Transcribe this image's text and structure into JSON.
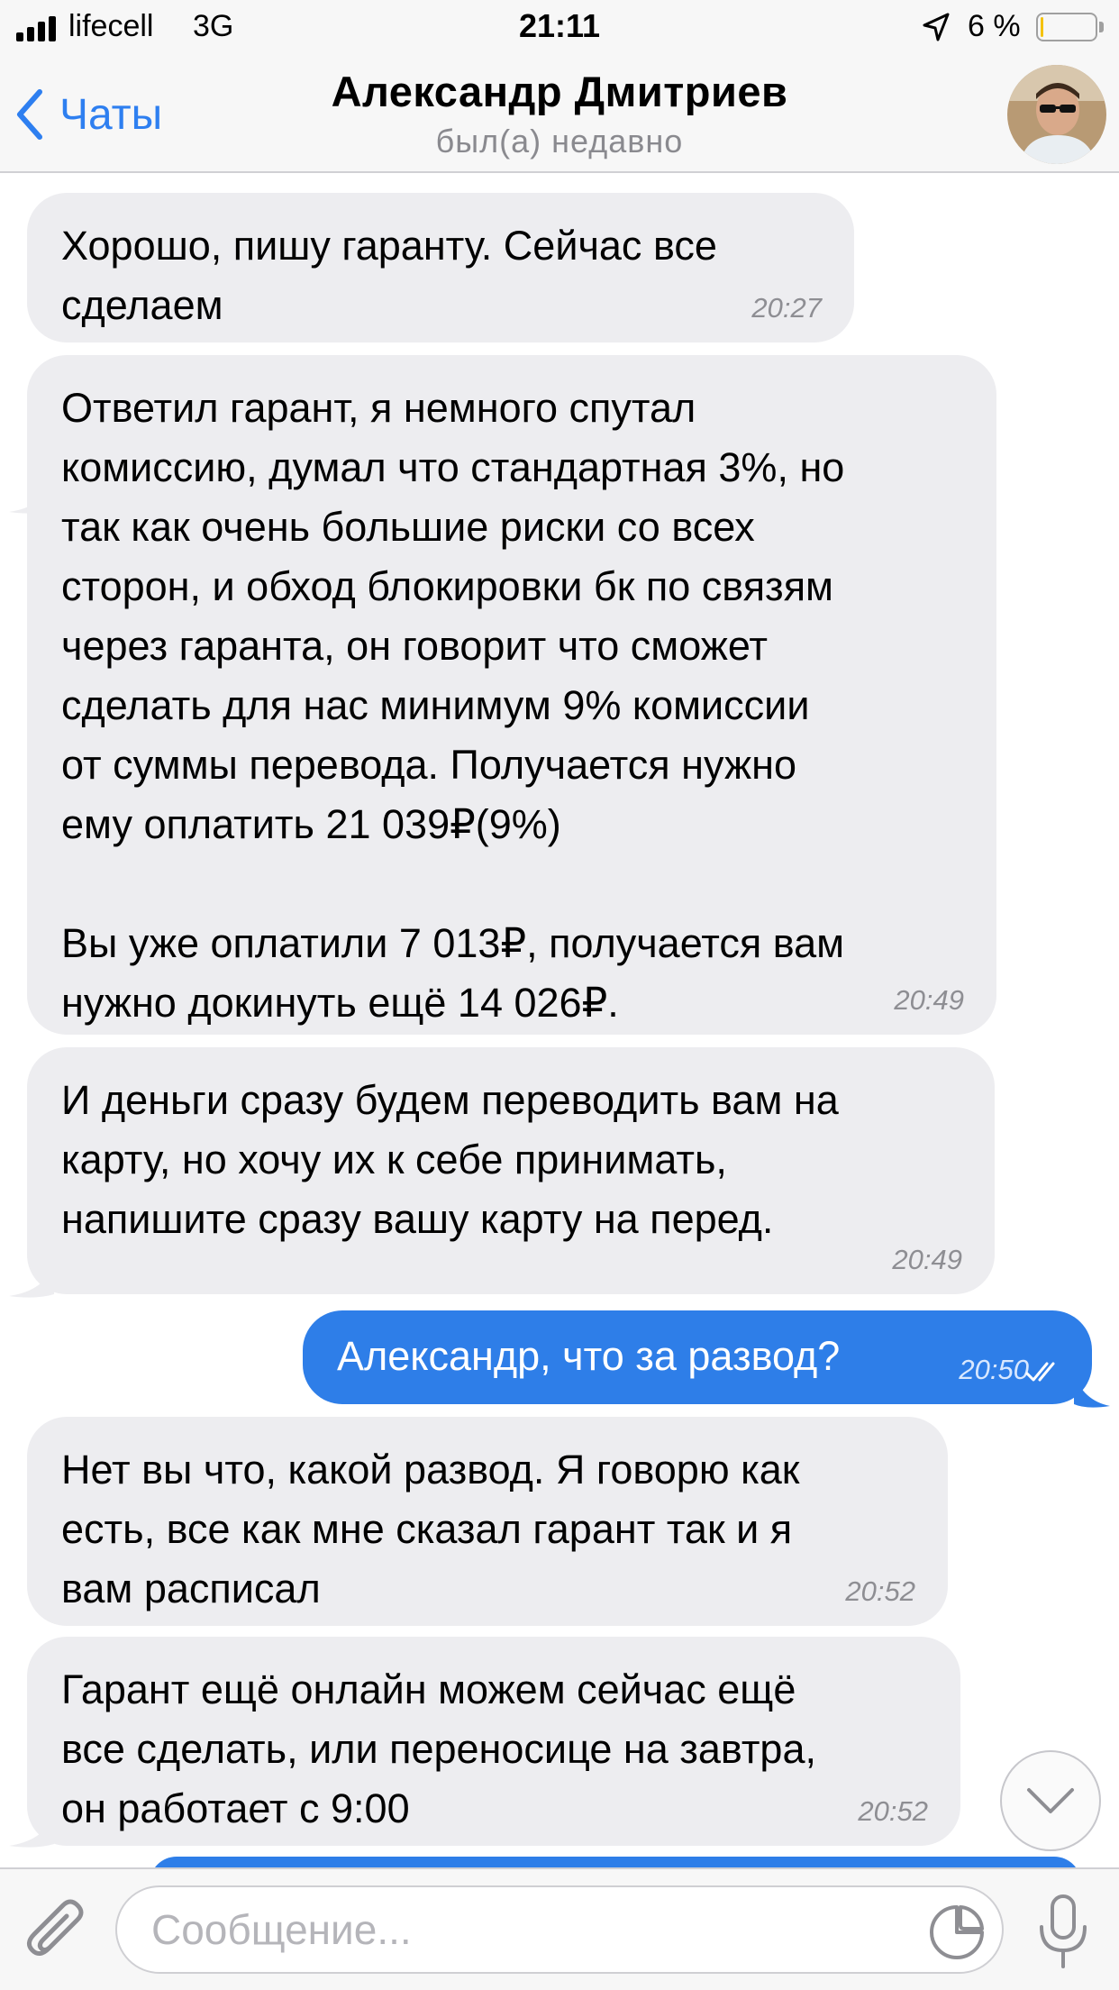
{
  "status_bar": {
    "carrier": "lifecell",
    "network": "3G",
    "time": "21:11",
    "battery_percent": "6 %",
    "battery_level": 0.06,
    "battery_color": "#f4c20d"
  },
  "header": {
    "back_label": "Чаты",
    "title": "Александр Дмитриев",
    "status": "был(а) недавно",
    "accent": "#2e7ff0"
  },
  "messages": [
    {
      "direction": "in",
      "text": "Хорошо, пишу гаранту. Сейчас все\nсделаем",
      "time": "20:27"
    },
    {
      "direction": "in",
      "text": "Ответил гарант, я немного спутал\nкомиссию, думал что стандартная 3%, но\nтак как очень большие риски со всех\nсторон, и обход блокировки бк по связям\nчерез гаранта, он говорит что сможет\nсделать для нас минимум 9% комиссии\nот суммы перевода. Получается нужно\nему оплатить 21 039₽(9%)\n\nВы уже оплатили 7 013₽, получается вам\nнужно докинуть ещё 14 026₽.",
      "time": "20:49"
    },
    {
      "direction": "in",
      "text": "И деньги сразу будем переводить вам на\nкарту, но хочу их к себе принимать,\nнапишите сразу вашу карту на перед.",
      "time": "20:49"
    },
    {
      "direction": "out",
      "text": "Александр, что за развод?",
      "time": "20:50",
      "read": true
    },
    {
      "direction": "in",
      "text": "Нет вы что, какой развод. Я говорю как\nесть, все как мне сказал гарант так и я\nвам расписал",
      "time": "20:52"
    },
    {
      "direction": "in",
      "text": "Гарант ещё онлайн можем сейчас ещё\nвсе сделать, или переносице на завтра,\nон работает с 9:00",
      "time": "20:52"
    }
  ],
  "input": {
    "placeholder": "Сообщение..."
  },
  "icons": {
    "back": "chevron-left-icon",
    "attach": "paperclip-icon",
    "sticker": "sticker-icon",
    "mic": "microphone-icon",
    "scroll": "chevron-down-icon",
    "location": "location-arrow-icon",
    "read": "double-check-icon"
  },
  "colors": {
    "incoming_bubble": "#ededf0",
    "outgoing_bubble": "#2e7ee8"
  }
}
